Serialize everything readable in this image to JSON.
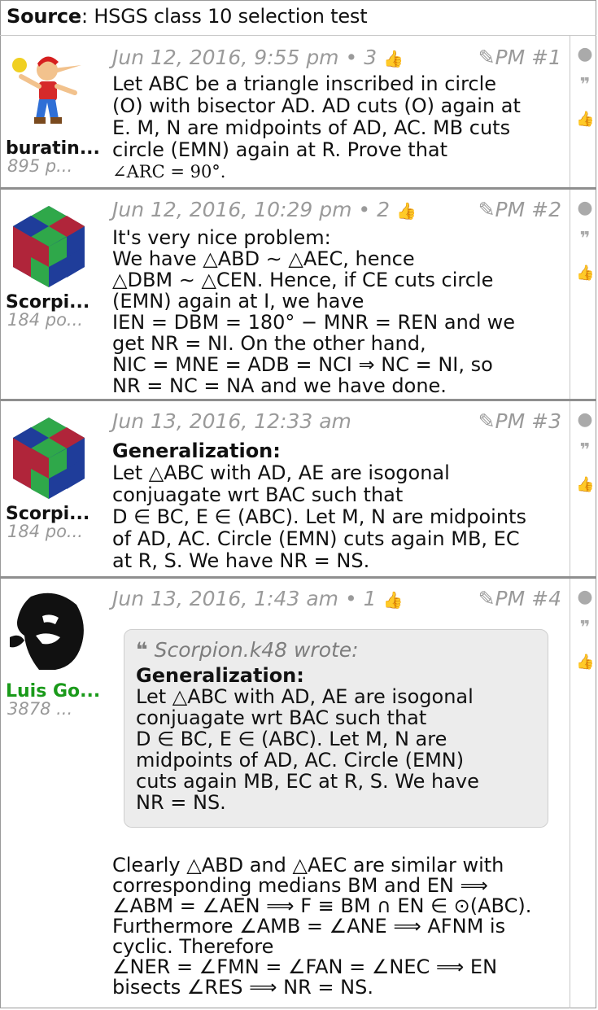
{
  "source": {
    "label": "Source",
    "text": ": HSGS class 10 selection test"
  },
  "posts": [
    {
      "user": "buratin...",
      "points": "895 p...",
      "user_color": "#000000",
      "date": "Jun 12, 2016, 9:55 pm",
      "likes": "3",
      "pm": "PM #1",
      "lines": [
        "Let ABC be a triangle inscribed in circle",
        "(O) with bisector AD. AD cuts (O) again at",
        "E. M, N are midpoints of AD, AC. MB cuts",
        "circle (EMN) again at R. Prove that",
        "∠ARC = 90°."
      ]
    },
    {
      "user": "Scorpi...",
      "points": "184 po...",
      "user_color": "#000000",
      "date": "Jun 12, 2016, 10:29 pm",
      "likes": "2",
      "pm": "PM #2",
      "lines": [
        "It's very nice problem:",
        "We have △ABD ∼ △AEC, hence",
        "△DBM ∼ △CEN. Hence, if CE cuts circle",
        "(EMN) again at I, we have",
        "IEN = DBM = 180° − MNR = REN and we",
        "get NR = NI. On the other hand,",
        "NIC = MNE = ADB = NCI ⇒ NC = NI, so",
        "NR = NC = NA and we have done."
      ]
    },
    {
      "user": "Scorpi...",
      "points": "184 po...",
      "user_color": "#000000",
      "date": "Jun 13, 2016, 12:33 am",
      "likes": "",
      "pm": "PM #3",
      "heading": "Generalization:",
      "lines": [
        "Let △ABC with AD, AE are isogonal",
        "conjuagate wrt BAC such that",
        "D ∈ BC, E ∈ (ABC). Let M, N are midpoints",
        "of AD, AC. Circle (EMN) cuts again MB, EC",
        "at R, S. We have NR = NS."
      ]
    },
    {
      "user": "Luis Go...",
      "points": "3878 ...",
      "user_color": "#1a9a1a",
      "date": "Jun 13, 2016, 1:43 am",
      "likes": "1",
      "pm": "PM #4",
      "quote": {
        "author": "Scorpion.k48 wrote:",
        "heading": "Generalization:",
        "lines": [
          "Let △ABC with AD, AE are isogonal",
          "conjuagate wrt BAC such that",
          "D ∈ BC, E ∈ (ABC). Let M, N are",
          "midpoints of AD, AC. Circle (EMN)",
          "cuts again MB, EC at R, S. We have",
          "NR = NS."
        ]
      },
      "lines": [
        "Clearly △ABD and △AEC are similar with",
        "corresponding medians BM and EN ⟹",
        "∠ABM = ∠AEN ⟹ F ≡ BM ∩ EN ∈ ⊙(ABC).",
        "Furthermore ∠AMB = ∠ANE ⟹ AFNM is",
        "cyclic. Therefore",
        "∠NER = ∠FMN = ∠FAN = ∠NEC ⟹ EN",
        "bisects ∠RES ⟹ NR = NS."
      ]
    }
  ],
  "icons": {
    "report": "exclamation-icon",
    "quote": "quote-icon",
    "like": "thumbs-up-icon",
    "edit": "edit-icon"
  }
}
